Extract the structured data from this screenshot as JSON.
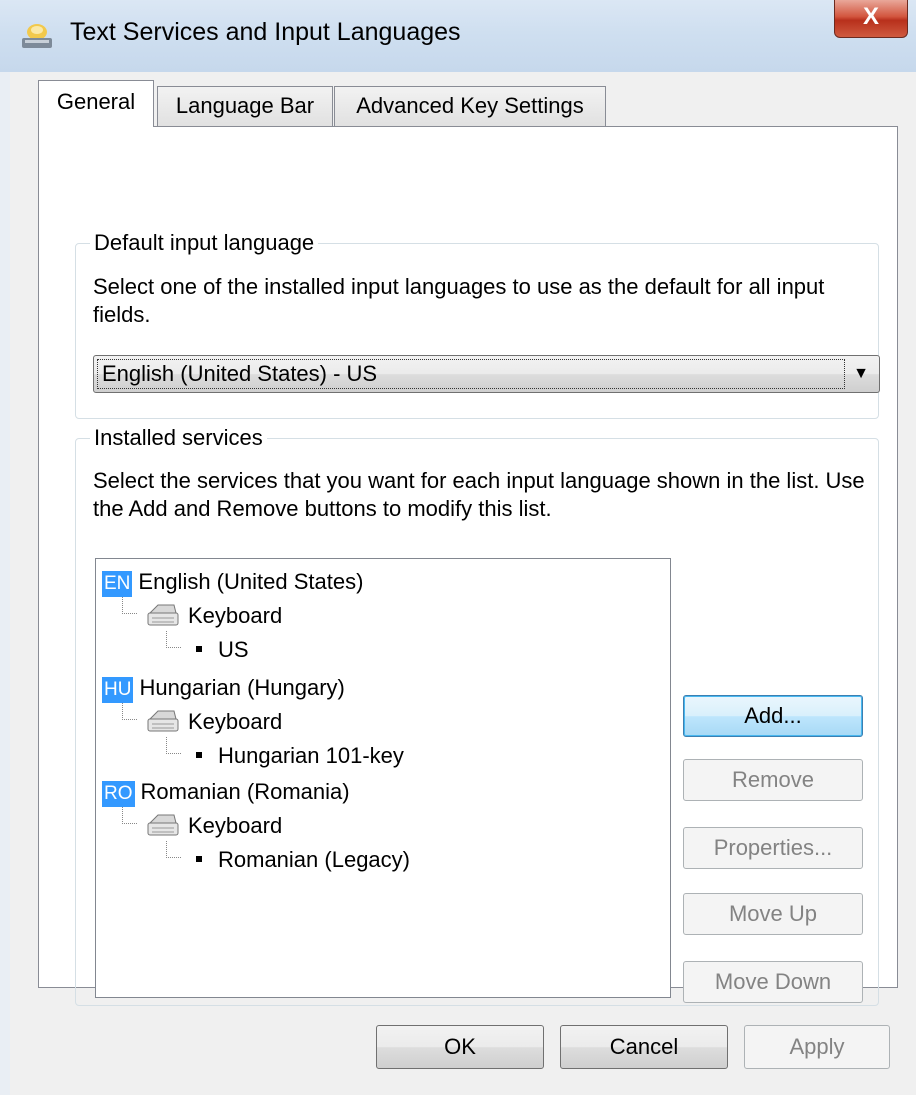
{
  "window": {
    "title": "Text Services and Input Languages",
    "close_glyph": "X"
  },
  "tabs": [
    {
      "label": "General",
      "active": true
    },
    {
      "label": "Language Bar",
      "active": false
    },
    {
      "label": "Advanced Key Settings",
      "active": false
    }
  ],
  "default_input": {
    "legend": "Default input language",
    "description": "Select one of the installed input languages to use as the default for all input fields.",
    "selected": "English (United States) - US"
  },
  "installed_services": {
    "legend": "Installed services",
    "description": "Select the services that you want for each input language shown in the list. Use the Add and Remove buttons to modify this list.",
    "languages": [
      {
        "code": "EN",
        "name": "English (United States)",
        "category": "Keyboard",
        "layout": "US"
      },
      {
        "code": "HU",
        "name": "Hungarian (Hungary)",
        "category": "Keyboard",
        "layout": "Hungarian 101-key"
      },
      {
        "code": "RO",
        "name": "Romanian (Romania)",
        "category": "Keyboard",
        "layout": "Romanian (Legacy)"
      }
    ],
    "buttons": {
      "add": "Add...",
      "remove": "Remove",
      "properties": "Properties...",
      "move_up": "Move Up",
      "move_down": "Move Down"
    }
  },
  "footer": {
    "ok": "OK",
    "cancel": "Cancel",
    "apply": "Apply"
  },
  "colors": {
    "badge": "#3399ff",
    "close": "#c8432b"
  }
}
